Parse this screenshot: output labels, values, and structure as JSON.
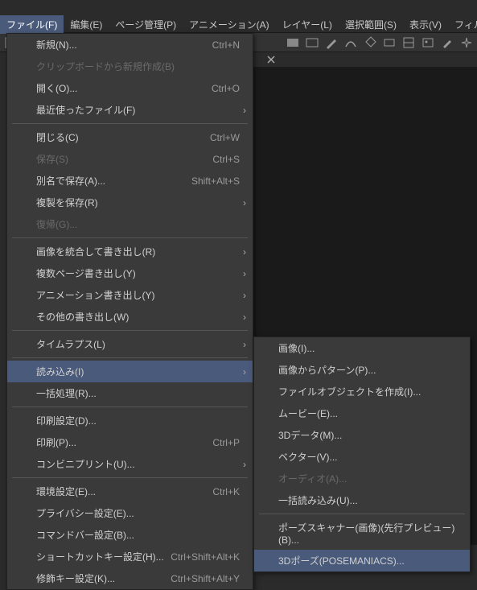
{
  "menubar": {
    "file": "ファイル(F)",
    "edit": "編集(E)",
    "page": "ページ管理(P)",
    "animation": "アニメーション(A)",
    "layer": "レイヤー(L)",
    "selection": "選択範囲(S)",
    "view": "表示(V)",
    "filter": "フィルター(I)"
  },
  "file_menu": {
    "new": "新規(N)...",
    "new_shortcut": "Ctrl+N",
    "clipboard_new": "クリップボードから新規作成(B)",
    "open": "開く(O)...",
    "open_shortcut": "Ctrl+O",
    "recent": "最近使ったファイル(F)",
    "close": "閉じる(C)",
    "close_shortcut": "Ctrl+W",
    "save": "保存(S)",
    "save_shortcut": "Ctrl+S",
    "save_as": "別名で保存(A)...",
    "save_as_shortcut": "Shift+Alt+S",
    "save_dup": "複製を保存(R)",
    "revert": "復帰(G)...",
    "export_merged": "画像を統合して書き出し(R)",
    "export_multi": "複数ページ書き出し(Y)",
    "export_anim": "アニメーション書き出し(Y)",
    "export_other": "その他の書き出し(W)",
    "timelapse": "タイムラプス(L)",
    "import": "読み込み(I)",
    "batch": "一括処理(R)...",
    "print_setup": "印刷設定(D)...",
    "print": "印刷(P)...",
    "print_shortcut": "Ctrl+P",
    "convenience_print": "コンビニプリント(U)...",
    "env_settings": "環境設定(E)...",
    "env_shortcut": "Ctrl+K",
    "privacy": "プライバシー設定(E)...",
    "commandbar": "コマンドバー設定(B)...",
    "shortcut": "ショートカットキー設定(H)...",
    "shortcut_shortcut": "Ctrl+Shift+Alt+K",
    "modifier": "修飾キー設定(K)...",
    "modifier_shortcut": "Ctrl+Shift+Alt+Y"
  },
  "import_submenu": {
    "image": "画像(I)...",
    "pattern": "画像からパターン(P)...",
    "file_object": "ファイルオブジェクトを作成(I)...",
    "movie": "ムービー(E)...",
    "data3d": "3Dデータ(M)...",
    "vector": "ベクター(V)...",
    "audio": "オーディオ(A)...",
    "batch_import": "一括読み込み(U)...",
    "pose_scanner": "ポーズスキャナー(画像)(先行プレビュー)(B)...",
    "pose3d": "3Dポーズ(POSEMANIACS)..."
  }
}
